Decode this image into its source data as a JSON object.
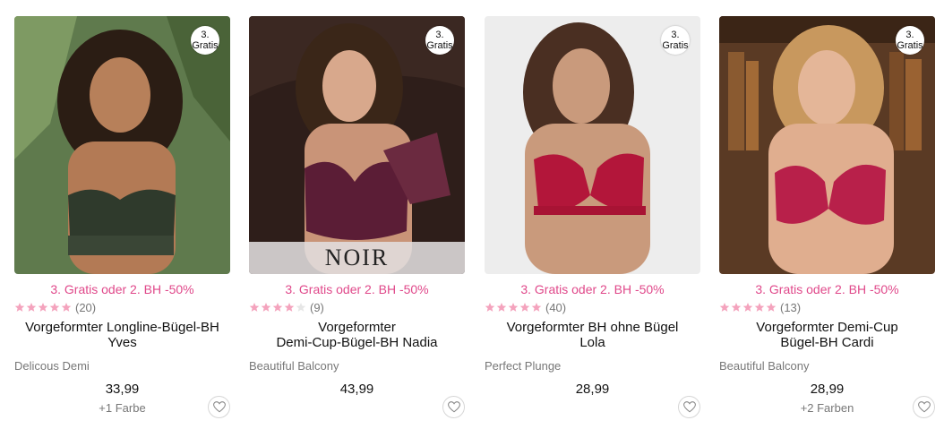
{
  "products": [
    {
      "badge": [
        "3.",
        "Gratis"
      ],
      "promo": "3. Gratis oder 2. BH -50%",
      "rating": 4,
      "reviews": "(20)",
      "title_lines": [
        "Vorgeformter Longline-Bügel-BH",
        "Yves"
      ],
      "line": "Delicous Demi",
      "price": "33,99",
      "colors": "+1 Farbe",
      "brand_overlay": ""
    },
    {
      "badge": [
        "3.",
        "Gratis"
      ],
      "promo": "3. Gratis oder 2. BH -50%",
      "rating": 4,
      "reviews": "(9)",
      "title_lines": [
        "Vorgeformter",
        "Demi-Cup-Bügel-BH Nadia"
      ],
      "line": "Beautiful Balcony",
      "price": "43,99",
      "colors": "",
      "brand_overlay": "NOIR"
    },
    {
      "badge": [
        "3.",
        "Gratis"
      ],
      "promo": "3. Gratis oder 2. BH -50%",
      "rating": 4,
      "reviews": "(40)",
      "title_lines": [
        "Vorgeformter BH ohne Bügel",
        "Lola"
      ],
      "line": "Perfect Plunge",
      "price": "28,99",
      "colors": "",
      "brand_overlay": ""
    },
    {
      "badge": [
        "3.",
        "Gratis"
      ],
      "promo": "3. Gratis oder 2. BH -50%",
      "rating": 4,
      "reviews": "(13)",
      "title_lines": [
        "Vorgeformter Demi-Cup",
        "Bügel-BH Cardi"
      ],
      "line": "Beautiful Balcony",
      "price": "28,99",
      "colors": "+2 Farben",
      "brand_overlay": ""
    }
  ],
  "icons": {
    "star": "star-icon",
    "wishlist": "heart-icon"
  },
  "colors": {
    "promo": "#e0488a",
    "star": "#f4a3bd"
  }
}
